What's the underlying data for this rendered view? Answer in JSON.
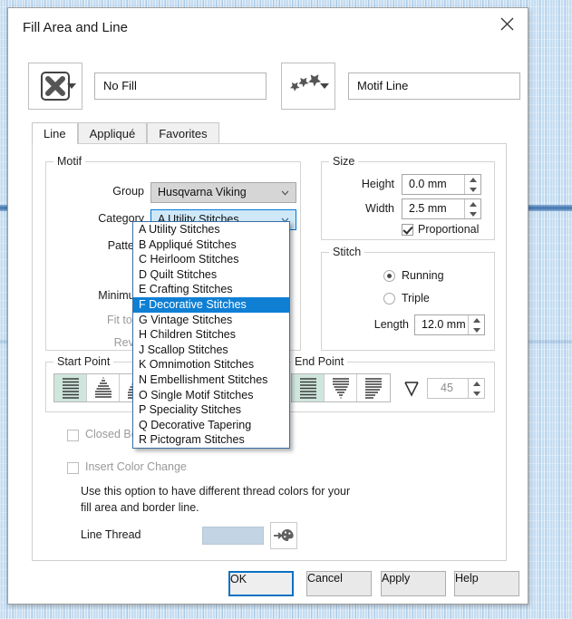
{
  "window": {
    "title": "Fill Area and Line",
    "close_icon": "close-icon"
  },
  "top": {
    "fill_icon": "no-fill-x-icon",
    "fill_value": "No Fill",
    "line_icon": "motif-stars-icon",
    "line_value": "Motif Line"
  },
  "tabs": [
    {
      "label": "Line",
      "active": true
    },
    {
      "label": "Appliqué",
      "active": false
    },
    {
      "label": "Favorites",
      "active": false
    }
  ],
  "motif": {
    "legend": "Motif",
    "group_label": "Group",
    "group_value": "Husqvarna Viking",
    "category_label": "Category",
    "category_value": "A Utility Stitches",
    "pattern_label": "Pattern",
    "minimum_label": "Minimum",
    "fit_to_line_label": "Fit to Li",
    "reverse_label": "Rever"
  },
  "dropdown": {
    "selected_index": 5,
    "items": [
      "A Utility Stitches",
      "B Appliqué Stitches",
      "C Heirloom Stitches",
      "D Quilt Stitches",
      "E Crafting Stitches",
      "F Decorative Stitches",
      "G Vintage Stitches",
      "H Children Stitches",
      "J Scallop Stitches",
      "K Omnimotion Stitches",
      "N Embellishment Stitches",
      "O Single Motif Stitches",
      "P Speciality Stitches",
      "Q Decorative Tapering",
      "R Pictogram Stitches"
    ]
  },
  "size": {
    "legend": "Size",
    "height_label": "Height",
    "height_value": "0.0 mm",
    "width_label": "Width",
    "width_value": "2.5 mm",
    "proportional_label": "Proportional",
    "proportional_checked": true
  },
  "stitch": {
    "legend": "Stitch",
    "running_label": "Running",
    "running_selected": true,
    "triple_label": "Triple",
    "triple_selected": false,
    "length_label": "Length",
    "length_value": "12.0 mm"
  },
  "start_point": {
    "legend": "Start Point",
    "selected_index": 0,
    "options": [
      "start-flat-icon",
      "start-taper-up-icon",
      "start-triangle-icon",
      "start-partial-icon"
    ]
  },
  "end_point": {
    "legend": "End Point",
    "selected_index": 0,
    "options": [
      "end-flat-icon",
      "end-taper-down-icon",
      "end-wedge-icon"
    ],
    "angle_icon": "angle-icon",
    "angle_value": "45"
  },
  "options": {
    "closed_border_label": "Closed Bo",
    "closed_border_checked": false,
    "insert_color_change_label": "Insert Color Change",
    "insert_color_change_checked": false,
    "note_line1": "Use this option to have different thread colors for your",
    "note_line2": "fill area and border line.",
    "line_thread_label": "Line Thread",
    "line_thread_color": "#c3d4e4",
    "palette_icon": "thread-palette-icon"
  },
  "footer": {
    "ok": "OK",
    "cancel": "Cancel",
    "apply": "Apply",
    "help": "Help"
  },
  "colors": {
    "accent": "#0078d7",
    "highlight": "#0f7fd4",
    "desktop": "#c5ddf2"
  }
}
